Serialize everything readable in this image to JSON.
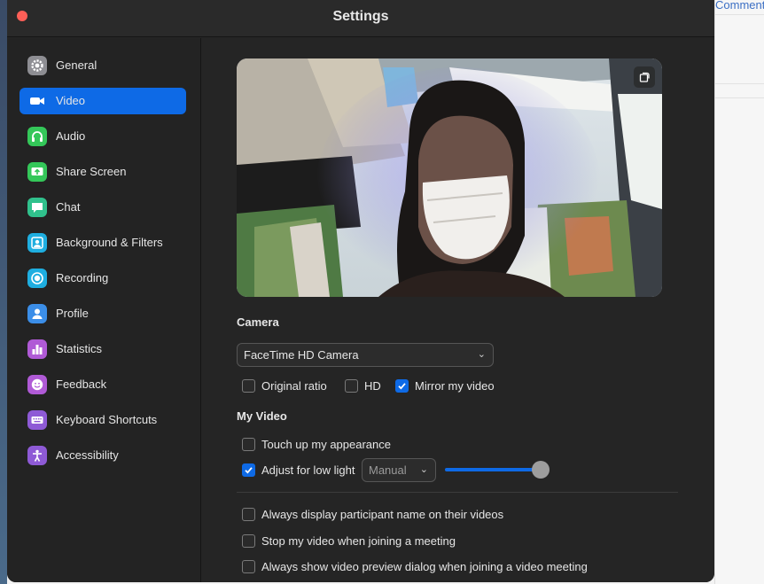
{
  "background_doc": {
    "comment_label": "Comment"
  },
  "window": {
    "title": "Settings"
  },
  "sidebar": {
    "items": [
      {
        "label": "General",
        "icon": "gear-icon",
        "color": "#8e8e93",
        "active": false
      },
      {
        "label": "Video",
        "icon": "video-camera-icon",
        "color": "#0e6ae6",
        "active": true
      },
      {
        "label": "Audio",
        "icon": "headphones-icon",
        "color": "#34c759",
        "active": false
      },
      {
        "label": "Share Screen",
        "icon": "share-screen-icon",
        "color": "#34c759",
        "active": false
      },
      {
        "label": "Chat",
        "icon": "chat-bubble-icon",
        "color": "#30c18c",
        "active": false
      },
      {
        "label": "Background & Filters",
        "icon": "background-person-icon",
        "color": "#1eaee0",
        "active": false
      },
      {
        "label": "Recording",
        "icon": "record-icon",
        "color": "#1eaee0",
        "active": false
      },
      {
        "label": "Profile",
        "icon": "person-icon",
        "color": "#3b8ee8",
        "active": false
      },
      {
        "label": "Statistics",
        "icon": "bar-chart-icon",
        "color": "#b05ad6",
        "active": false
      },
      {
        "label": "Feedback",
        "icon": "smiley-icon",
        "color": "#b05ad6",
        "active": false
      },
      {
        "label": "Keyboard Shortcuts",
        "icon": "keyboard-icon",
        "color": "#8e5ad6",
        "active": false
      },
      {
        "label": "Accessibility",
        "icon": "accessibility-icon",
        "color": "#8e5ad6",
        "active": false
      }
    ]
  },
  "camera": {
    "section_label": "Camera",
    "selected": "FaceTime HD Camera",
    "options": [
      {
        "label": "Original ratio",
        "checked": false
      },
      {
        "label": "HD",
        "checked": false
      },
      {
        "label": "Mirror my video",
        "checked": true
      }
    ]
  },
  "my_video": {
    "section_label": "My Video",
    "touch_up": {
      "label": "Touch up my appearance",
      "checked": false
    },
    "low_light": {
      "label": "Adjust for low light",
      "checked": true,
      "mode": "Manual",
      "level": 1.0
    }
  },
  "more_options": [
    {
      "label": "Always display participant name on their videos",
      "checked": false
    },
    {
      "label": "Stop my video when joining a meeting",
      "checked": false
    },
    {
      "label": "Always show video preview dialog when joining a video meeting",
      "checked": false
    }
  ],
  "colors": {
    "accent": "#0e6ae6",
    "window_bg": "#252525",
    "close": "#fe5f57"
  }
}
